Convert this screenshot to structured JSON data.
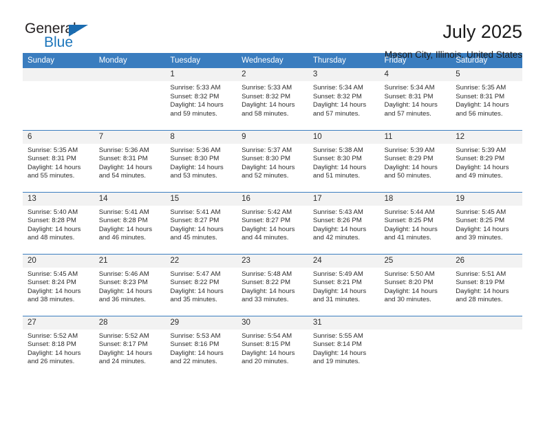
{
  "brand": {
    "name_primary": "General",
    "name_secondary": "Blue",
    "accent_color": "#1b75bb",
    "triangle_color": "#1b6cb0"
  },
  "header": {
    "title": "July 2025",
    "subtitle": "Mason City, Illinois, United States",
    "header_bg_color": "#3a7dbf",
    "daynum_bg_color": "#f2f2f2"
  },
  "weekday_headers": [
    "Sunday",
    "Monday",
    "Tuesday",
    "Wednesday",
    "Thursday",
    "Friday",
    "Saturday"
  ],
  "weeks": [
    [
      {
        "day": "",
        "sunrise": "",
        "sunset": "",
        "daylight1": "",
        "daylight2": ""
      },
      {
        "day": "",
        "sunrise": "",
        "sunset": "",
        "daylight1": "",
        "daylight2": ""
      },
      {
        "day": "1",
        "sunrise": "Sunrise: 5:33 AM",
        "sunset": "Sunset: 8:32 PM",
        "daylight1": "Daylight: 14 hours",
        "daylight2": "and 59 minutes."
      },
      {
        "day": "2",
        "sunrise": "Sunrise: 5:33 AM",
        "sunset": "Sunset: 8:32 PM",
        "daylight1": "Daylight: 14 hours",
        "daylight2": "and 58 minutes."
      },
      {
        "day": "3",
        "sunrise": "Sunrise: 5:34 AM",
        "sunset": "Sunset: 8:32 PM",
        "daylight1": "Daylight: 14 hours",
        "daylight2": "and 57 minutes."
      },
      {
        "day": "4",
        "sunrise": "Sunrise: 5:34 AM",
        "sunset": "Sunset: 8:31 PM",
        "daylight1": "Daylight: 14 hours",
        "daylight2": "and 57 minutes."
      },
      {
        "day": "5",
        "sunrise": "Sunrise: 5:35 AM",
        "sunset": "Sunset: 8:31 PM",
        "daylight1": "Daylight: 14 hours",
        "daylight2": "and 56 minutes."
      }
    ],
    [
      {
        "day": "6",
        "sunrise": "Sunrise: 5:35 AM",
        "sunset": "Sunset: 8:31 PM",
        "daylight1": "Daylight: 14 hours",
        "daylight2": "and 55 minutes."
      },
      {
        "day": "7",
        "sunrise": "Sunrise: 5:36 AM",
        "sunset": "Sunset: 8:31 PM",
        "daylight1": "Daylight: 14 hours",
        "daylight2": "and 54 minutes."
      },
      {
        "day": "8",
        "sunrise": "Sunrise: 5:36 AM",
        "sunset": "Sunset: 8:30 PM",
        "daylight1": "Daylight: 14 hours",
        "daylight2": "and 53 minutes."
      },
      {
        "day": "9",
        "sunrise": "Sunrise: 5:37 AM",
        "sunset": "Sunset: 8:30 PM",
        "daylight1": "Daylight: 14 hours",
        "daylight2": "and 52 minutes."
      },
      {
        "day": "10",
        "sunrise": "Sunrise: 5:38 AM",
        "sunset": "Sunset: 8:30 PM",
        "daylight1": "Daylight: 14 hours",
        "daylight2": "and 51 minutes."
      },
      {
        "day": "11",
        "sunrise": "Sunrise: 5:39 AM",
        "sunset": "Sunset: 8:29 PM",
        "daylight1": "Daylight: 14 hours",
        "daylight2": "and 50 minutes."
      },
      {
        "day": "12",
        "sunrise": "Sunrise: 5:39 AM",
        "sunset": "Sunset: 8:29 PM",
        "daylight1": "Daylight: 14 hours",
        "daylight2": "and 49 minutes."
      }
    ],
    [
      {
        "day": "13",
        "sunrise": "Sunrise: 5:40 AM",
        "sunset": "Sunset: 8:28 PM",
        "daylight1": "Daylight: 14 hours",
        "daylight2": "and 48 minutes."
      },
      {
        "day": "14",
        "sunrise": "Sunrise: 5:41 AM",
        "sunset": "Sunset: 8:28 PM",
        "daylight1": "Daylight: 14 hours",
        "daylight2": "and 46 minutes."
      },
      {
        "day": "15",
        "sunrise": "Sunrise: 5:41 AM",
        "sunset": "Sunset: 8:27 PM",
        "daylight1": "Daylight: 14 hours",
        "daylight2": "and 45 minutes."
      },
      {
        "day": "16",
        "sunrise": "Sunrise: 5:42 AM",
        "sunset": "Sunset: 8:27 PM",
        "daylight1": "Daylight: 14 hours",
        "daylight2": "and 44 minutes."
      },
      {
        "day": "17",
        "sunrise": "Sunrise: 5:43 AM",
        "sunset": "Sunset: 8:26 PM",
        "daylight1": "Daylight: 14 hours",
        "daylight2": "and 42 minutes."
      },
      {
        "day": "18",
        "sunrise": "Sunrise: 5:44 AM",
        "sunset": "Sunset: 8:25 PM",
        "daylight1": "Daylight: 14 hours",
        "daylight2": "and 41 minutes."
      },
      {
        "day": "19",
        "sunrise": "Sunrise: 5:45 AM",
        "sunset": "Sunset: 8:25 PM",
        "daylight1": "Daylight: 14 hours",
        "daylight2": "and 39 minutes."
      }
    ],
    [
      {
        "day": "20",
        "sunrise": "Sunrise: 5:45 AM",
        "sunset": "Sunset: 8:24 PM",
        "daylight1": "Daylight: 14 hours",
        "daylight2": "and 38 minutes."
      },
      {
        "day": "21",
        "sunrise": "Sunrise: 5:46 AM",
        "sunset": "Sunset: 8:23 PM",
        "daylight1": "Daylight: 14 hours",
        "daylight2": "and 36 minutes."
      },
      {
        "day": "22",
        "sunrise": "Sunrise: 5:47 AM",
        "sunset": "Sunset: 8:22 PM",
        "daylight1": "Daylight: 14 hours",
        "daylight2": "and 35 minutes."
      },
      {
        "day": "23",
        "sunrise": "Sunrise: 5:48 AM",
        "sunset": "Sunset: 8:22 PM",
        "daylight1": "Daylight: 14 hours",
        "daylight2": "and 33 minutes."
      },
      {
        "day": "24",
        "sunrise": "Sunrise: 5:49 AM",
        "sunset": "Sunset: 8:21 PM",
        "daylight1": "Daylight: 14 hours",
        "daylight2": "and 31 minutes."
      },
      {
        "day": "25",
        "sunrise": "Sunrise: 5:50 AM",
        "sunset": "Sunset: 8:20 PM",
        "daylight1": "Daylight: 14 hours",
        "daylight2": "and 30 minutes."
      },
      {
        "day": "26",
        "sunrise": "Sunrise: 5:51 AM",
        "sunset": "Sunset: 8:19 PM",
        "daylight1": "Daylight: 14 hours",
        "daylight2": "and 28 minutes."
      }
    ],
    [
      {
        "day": "27",
        "sunrise": "Sunrise: 5:52 AM",
        "sunset": "Sunset: 8:18 PM",
        "daylight1": "Daylight: 14 hours",
        "daylight2": "and 26 minutes."
      },
      {
        "day": "28",
        "sunrise": "Sunrise: 5:52 AM",
        "sunset": "Sunset: 8:17 PM",
        "daylight1": "Daylight: 14 hours",
        "daylight2": "and 24 minutes."
      },
      {
        "day": "29",
        "sunrise": "Sunrise: 5:53 AM",
        "sunset": "Sunset: 8:16 PM",
        "daylight1": "Daylight: 14 hours",
        "daylight2": "and 22 minutes."
      },
      {
        "day": "30",
        "sunrise": "Sunrise: 5:54 AM",
        "sunset": "Sunset: 8:15 PM",
        "daylight1": "Daylight: 14 hours",
        "daylight2": "and 20 minutes."
      },
      {
        "day": "31",
        "sunrise": "Sunrise: 5:55 AM",
        "sunset": "Sunset: 8:14 PM",
        "daylight1": "Daylight: 14 hours",
        "daylight2": "and 19 minutes."
      },
      {
        "day": "",
        "sunrise": "",
        "sunset": "",
        "daylight1": "",
        "daylight2": ""
      },
      {
        "day": "",
        "sunrise": "",
        "sunset": "",
        "daylight1": "",
        "daylight2": ""
      }
    ]
  ]
}
